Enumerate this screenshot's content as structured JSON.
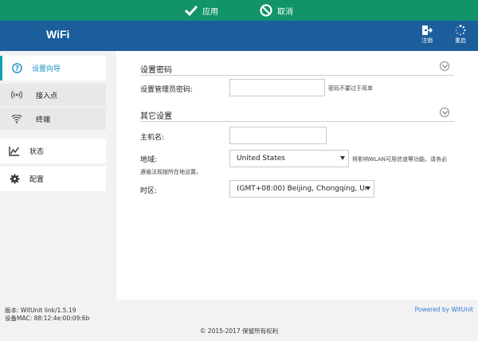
{
  "topbar": {
    "apply_label": "应用",
    "cancel_label": "取消"
  },
  "header": {
    "brand": "WiFi",
    "logout_label": "注销",
    "reboot_label": "重启"
  },
  "sidebar": {
    "wizard": "设置向导",
    "access_point": "接入点",
    "terminal": "终端",
    "status": "状态",
    "config": "配置"
  },
  "main": {
    "password_section": "设置密码",
    "admin_password_label": "设置管理员密码:",
    "admin_password_value": "",
    "password_hint": "密码不要过于简单",
    "other_section": "其它设置",
    "hostname_label": "主机名:",
    "hostname_value": "",
    "region_label": "地域:",
    "region_value": "United States",
    "region_hint_1": "将影响WLAN可用信道等功能。请务必",
    "region_hint_2": "遵循法规按所在地设置。",
    "timezone_label": "时区:",
    "timezone_value": "(GMT+08:00) Beijing, Chongqing, Ur"
  },
  "footer": {
    "version": "版本: WitUnit link/1.5.19",
    "mac": "设备MAC: 88:12:4e:00:09:6b",
    "powered": "Powered by WitUnit",
    "copyright": "© 2015-2017  保留所有权利"
  },
  "colors": {
    "topbar": "#12936a",
    "header": "#1c5e9b",
    "accent": "#1490c8",
    "link": "#2e7bd6"
  }
}
